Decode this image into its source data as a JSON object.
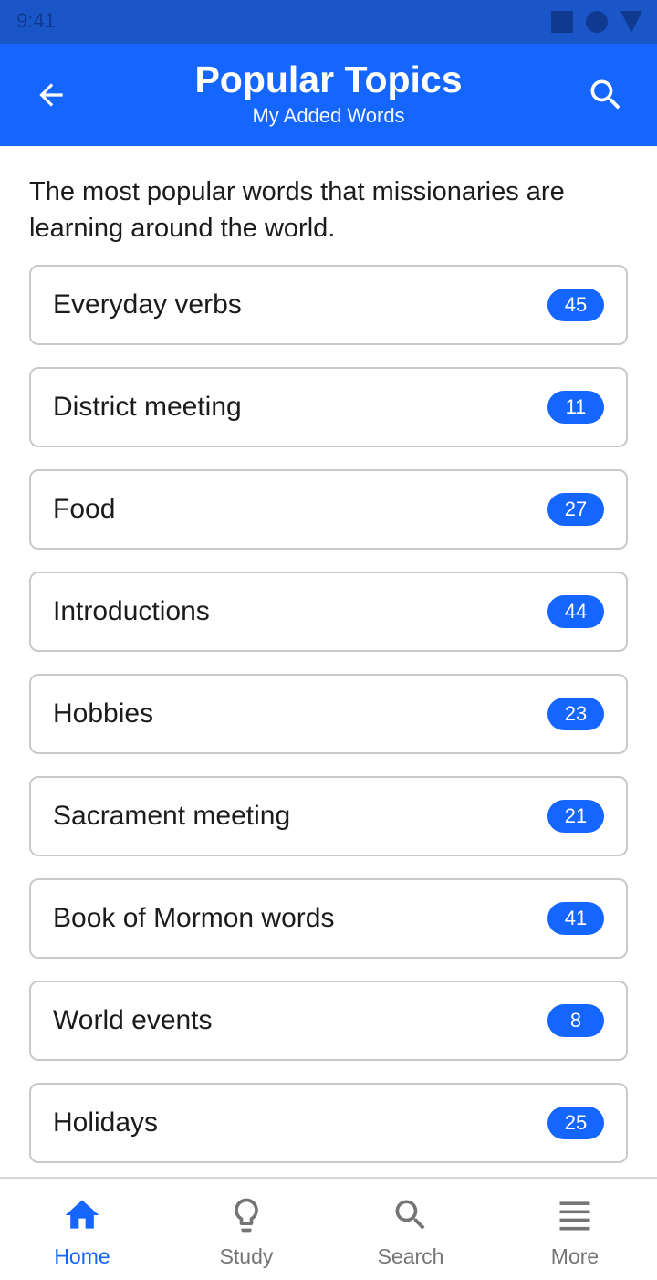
{
  "status_bar": {
    "time": "9:41"
  },
  "app_bar": {
    "title": "Popular Topics",
    "subtitle": "My Added Words",
    "back_icon": "arrow-back-icon",
    "search_icon": "search-icon"
  },
  "intro": "The most popular words that missionaries are learning around the world.",
  "topics": [
    {
      "label": "Everyday verbs",
      "count": "45"
    },
    {
      "label": "District meeting",
      "count": "11"
    },
    {
      "label": "Food",
      "count": "27"
    },
    {
      "label": "Introductions",
      "count": "44"
    },
    {
      "label": "Hobbies",
      "count": "23"
    },
    {
      "label": "Sacrament meeting",
      "count": "21"
    },
    {
      "label": "Book of Mormon words",
      "count": "41"
    },
    {
      "label": "World events",
      "count": "8"
    },
    {
      "label": "Holidays",
      "count": "25"
    }
  ],
  "bottom_nav": [
    {
      "label": "Home",
      "icon": "home-icon",
      "active": true
    },
    {
      "label": "Study",
      "icon": "lightbulb-icon",
      "active": false
    },
    {
      "label": "Search",
      "icon": "search-icon",
      "active": false
    },
    {
      "label": "More",
      "icon": "menu-icon",
      "active": false
    }
  ],
  "colors": {
    "primary": "#1565ff",
    "status_bar": "#1b56c9",
    "badge": "#1565ff",
    "inactive_nav": "#757575"
  }
}
